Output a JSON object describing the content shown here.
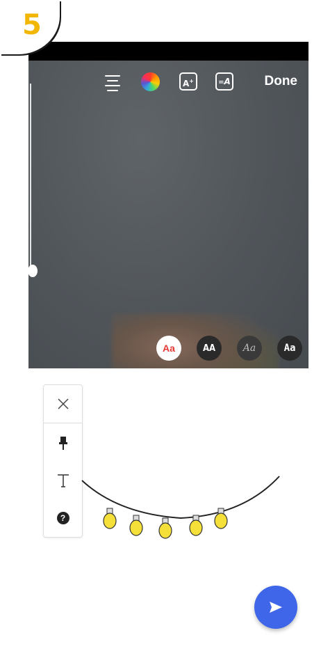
{
  "step": {
    "number": "5",
    "color": "#f2b705"
  },
  "editor_toolbar": {
    "align_icon": "text-align-icon",
    "color_icon": "color-wheel-icon",
    "effect_label": "A",
    "style_label": "A",
    "done_label": "Done"
  },
  "font_options": {
    "classic": "Aa",
    "modern": "AA",
    "script": "Aa",
    "typewriter": "Aa"
  },
  "tools": {
    "close_icon": "close-icon",
    "pin_icon": "pushpin-icon",
    "text_icon": "text-icon",
    "help_label": "?"
  },
  "send_button": {
    "icon": "send-icon",
    "color": "#3f66e8"
  },
  "illustration": {
    "bulb_count": 5,
    "bulb_color": "#f5e03a"
  }
}
